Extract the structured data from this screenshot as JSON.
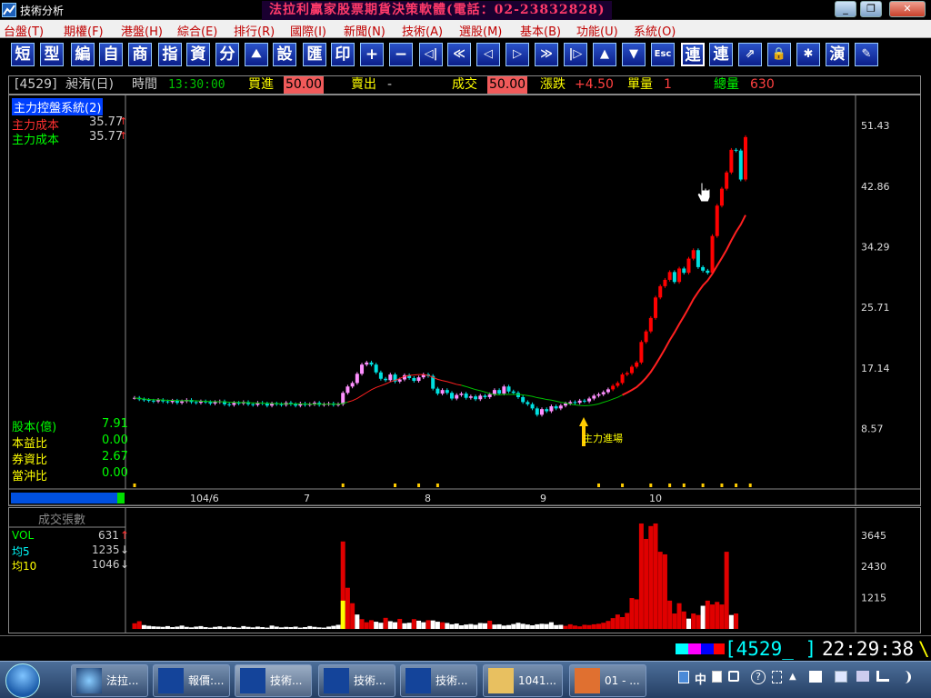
{
  "window": {
    "app_title": "技術分析",
    "banner": "法拉利贏家股票期貨決策軟體(電話：02-23832828)",
    "buttons": {
      "minimize": "_",
      "restore": "❐",
      "close": "✕"
    }
  },
  "menu": [
    "台盤(T)",
    "期權(F)",
    "港盤(H)",
    "綜合(E)",
    "排行(R)",
    "國際(I)",
    "新聞(N)",
    "技術(A)",
    "選股(M)",
    "基本(B)",
    "功能(U)",
    "系統(O)"
  ],
  "toolbar": [
    "短",
    "型",
    "編",
    "自",
    "商",
    "指",
    "資",
    "分",
    "⛰",
    "設",
    "匯",
    "印",
    "+",
    "−",
    "◁|",
    "≪",
    "◁",
    "▷",
    "≫",
    "|▷",
    "▲",
    "▼",
    "Esc",
    "連",
    "連",
    "⇗",
    "🔒",
    "✱",
    "演",
    "✎"
  ],
  "info": {
    "code": "[4529]",
    "name": "昶洧(日)",
    "time_label": "時間",
    "time": "13:30:00",
    "buy_label": "買進",
    "buy": "50.00",
    "sell_label": "賣出",
    "sell": "-",
    "deal_label": "成交",
    "deal": "50.00",
    "change_label": "漲跌",
    "change": "+4.50",
    "unit_label": "單量",
    "unit": "1",
    "total_label": "總量",
    "total": "630"
  },
  "indicator": {
    "title": "主力控盤系統(2)",
    "cost1_label": "主力成本",
    "cost1": "35.77",
    "cost2_label": "主力成本",
    "cost2": "35.77",
    "arrow": "↑",
    "annotation": "主力進場"
  },
  "fundamentals": [
    {
      "label": "股本(億)",
      "value": "7.91"
    },
    {
      "label": "本益比",
      "value": "0.00"
    },
    {
      "label": "券資比",
      "value": "2.67"
    },
    {
      "label": "當沖比",
      "value": "0.00"
    }
  ],
  "volume_panel": {
    "title": "成交張數",
    "rows": [
      {
        "label": "VOL",
        "value": "631",
        "arrow": "↑",
        "color": "#00ff00"
      },
      {
        "label": "均5",
        "value": "1235",
        "arrow": "↓",
        "color": "#00ffff"
      },
      {
        "label": "均10",
        "value": "1046",
        "arrow": "↓",
        "color": "#ffff00"
      }
    ]
  },
  "chart_data": [
    {
      "type": "candlestick",
      "title": "",
      "x_ticks": [
        "104/6",
        "7",
        "8",
        "9",
        "10"
      ],
      "y_ticks": [
        "51.43",
        "42.86",
        "34.29",
        "25.71",
        "17.14",
        "8.57"
      ],
      "ylim": [
        0,
        55.7
      ],
      "close": [
        12.9,
        12.7,
        12.6,
        12.5,
        12.4,
        12.6,
        12.4,
        12.3,
        12.5,
        12.2,
        12.4,
        12.6,
        12.3,
        12.2,
        12.4,
        12.3,
        12.1,
        12.3,
        12.4,
        12.0,
        11.9,
        12.2,
        12.1,
        12.3,
        12.0,
        11.9,
        12.2,
        12.1,
        11.8,
        12.1,
        12.0,
        11.9,
        12.2,
        12.0,
        11.8,
        12.1,
        11.9,
        12.0,
        12.2,
        11.9,
        12.0,
        12.1,
        11.9,
        12.0,
        13.6,
        14.5,
        15.0,
        16.3,
        17.6,
        17.9,
        17.6,
        16.5,
        15.6,
        15.4,
        16.2,
        15.2,
        15.5,
        16.1,
        15.7,
        15.3,
        15.8,
        16.2,
        16.0,
        14.2,
        13.5,
        14.0,
        13.6,
        12.8,
        13.3,
        13.5,
        12.9,
        13.1,
        12.7,
        13.2,
        13.0,
        13.4,
        14.0,
        13.5,
        14.5,
        13.8,
        13.6,
        13.0,
        12.3,
        12.0,
        11.4,
        10.5,
        11.3,
        11.0,
        11.7,
        11.4,
        11.8,
        12.1,
        12.3,
        12.2,
        12.5,
        12.4,
        12.8,
        13.2,
        13.4,
        13.7,
        14.1,
        14.6,
        15.0,
        16.2,
        16.4,
        17.3,
        17.9,
        20.8,
        22.3,
        24.2,
        27.1,
        28.7,
        29.6,
        30.7,
        29.3,
        31.2,
        30.6,
        32.6,
        33.8,
        31.4,
        30.9,
        30.6,
        35.8,
        40.1,
        42.5,
        44.8,
        48.0,
        47.9,
        43.8,
        49.8
      ],
      "ma_main_cost": [
        13.2,
        12.7,
        10.4,
        14.4,
        12.6,
        35.8
      ],
      "annotation": "主力進場"
    },
    {
      "type": "bar",
      "title": "成交張數",
      "y_ticks": [
        "3645",
        "2430",
        "1215"
      ],
      "ylim": [
        0,
        4700
      ],
      "values": [
        220,
        300,
        150,
        120,
        100,
        90,
        80,
        110,
        70,
        90,
        130,
        80,
        60,
        90,
        110,
        70,
        50,
        80,
        100,
        60,
        90,
        70,
        50,
        110,
        80,
        60,
        90,
        70,
        50,
        130,
        90,
        60,
        80,
        70,
        90,
        50,
        70,
        110,
        80,
        60,
        50,
        90,
        120,
        160,
        3400,
        1600,
        1000,
        560,
        380,
        260,
        340,
        280,
        240,
        430,
        300,
        260,
        390,
        220,
        240,
        380,
        320,
        260,
        340,
        330,
        280,
        260,
        230,
        180,
        210,
        140,
        170,
        190,
        160,
        230,
        220,
        320,
        170,
        180,
        130,
        150,
        190,
        240,
        200,
        170,
        140,
        180,
        200,
        190,
        260,
        150,
        160,
        120,
        180,
        130,
        100,
        160,
        150,
        180,
        200,
        240,
        310,
        420,
        560,
        460,
        620,
        1200,
        1150,
        4100,
        3500,
        4000,
        4100,
        3000,
        2900,
        1100,
        600,
        1000,
        680,
        400,
        600,
        540,
        900,
        1100,
        950,
        1050,
        950,
        3000,
        540,
        600
      ],
      "bar_colors": [
        "r",
        "r",
        "w",
        "w",
        "w",
        "w",
        "w",
        "w",
        "w",
        "w",
        "w",
        "w",
        "w",
        "w",
        "w",
        "w",
        "w",
        "w",
        "w",
        "w",
        "w",
        "w",
        "w",
        "w",
        "w",
        "w",
        "w",
        "w",
        "w",
        "w",
        "w",
        "w",
        "w",
        "w",
        "w",
        "w",
        "w",
        "w",
        "w",
        "w",
        "w",
        "w",
        "w",
        "w",
        "r",
        "r",
        "r",
        "w",
        "r",
        "r",
        "r",
        "w",
        "w",
        "r",
        "w",
        "w",
        "r",
        "w",
        "w",
        "r",
        "w",
        "w",
        "r",
        "w",
        "w",
        "r",
        "w",
        "w",
        "w",
        "w",
        "w",
        "w",
        "w",
        "w",
        "w",
        "r",
        "w",
        "w",
        "w",
        "w",
        "w",
        "w",
        "w",
        "w",
        "w",
        "w",
        "w",
        "w",
        "w",
        "w",
        "w",
        "r",
        "r",
        "r",
        "r",
        "r",
        "r",
        "r",
        "r",
        "r",
        "r",
        "r",
        "r",
        "r",
        "r",
        "r",
        "r",
        "r",
        "r",
        "r",
        "r",
        "r",
        "r",
        "r",
        "r",
        "r",
        "r",
        "w",
        "r",
        "r",
        "w",
        "r",
        "r",
        "r",
        "r",
        "r",
        "w",
        "r"
      ]
    }
  ],
  "status": {
    "code_box": "[4529_  ]",
    "clock": "22:29:38",
    "tail": "\\"
  },
  "taskbar": {
    "items": [
      "法拉...",
      "報價:...",
      "技術...",
      "技術...",
      "技術...",
      "1041...",
      "01 - ..."
    ],
    "tray": [
      "中",
      "?",
      "▲"
    ]
  }
}
